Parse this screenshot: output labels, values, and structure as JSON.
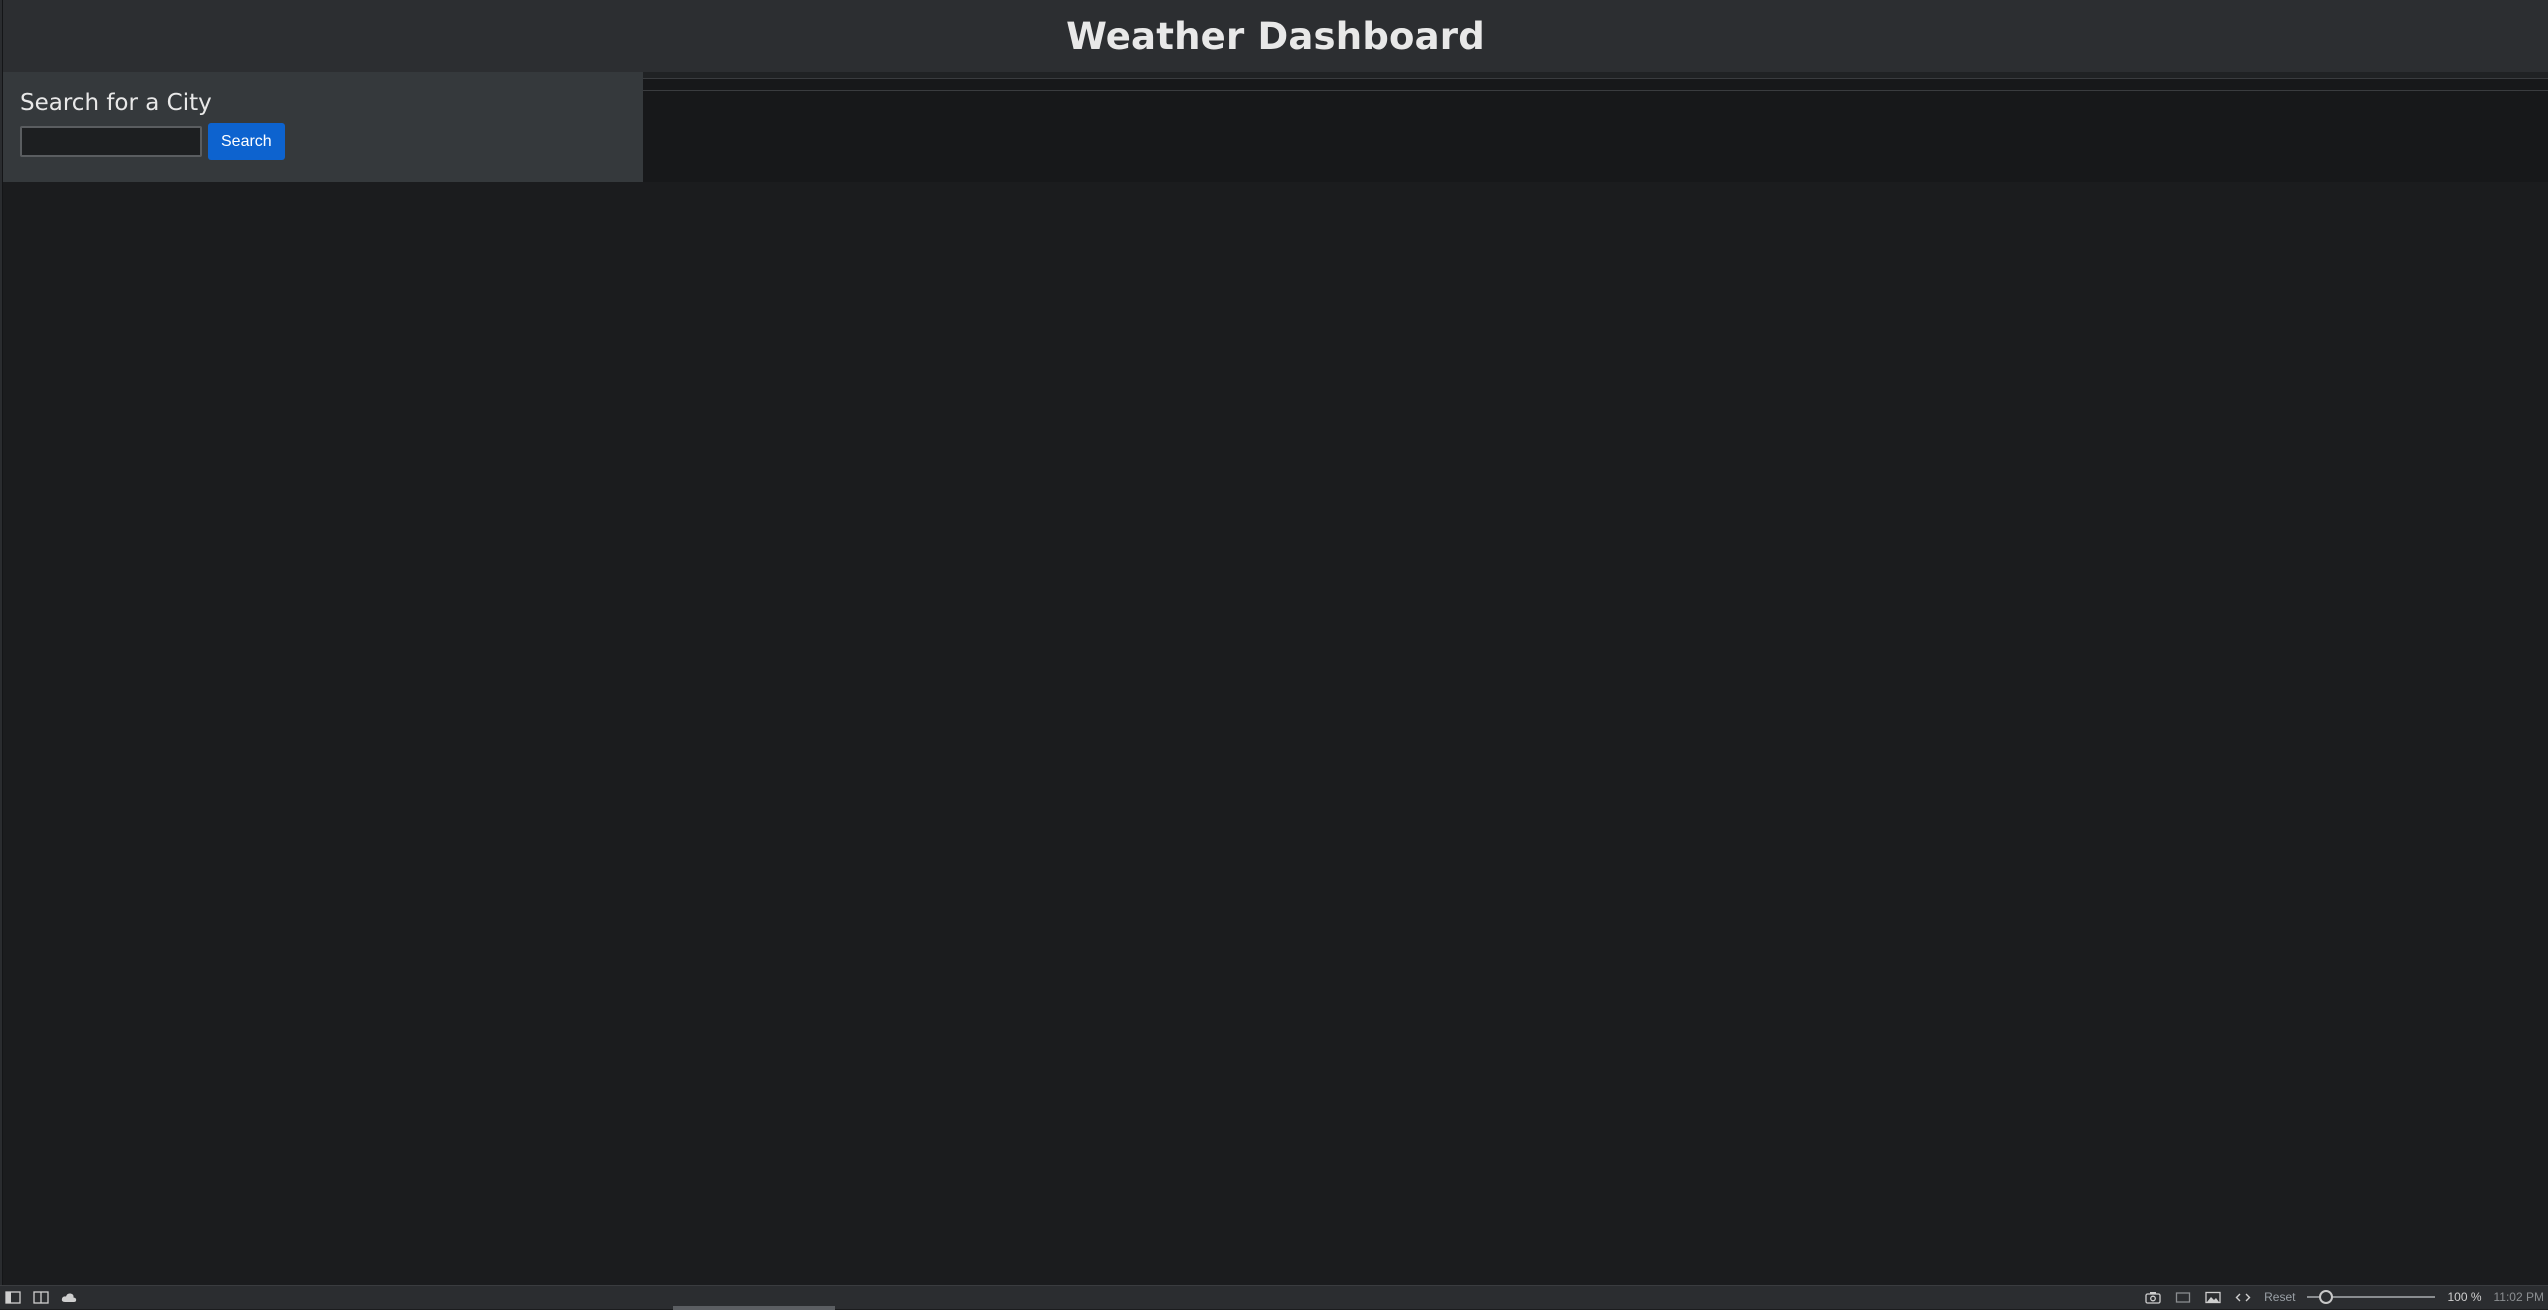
{
  "header": {
    "title": "Weather Dashboard"
  },
  "search": {
    "title": "Search for a City",
    "input_value": "",
    "input_placeholder": "",
    "button_label": "Search"
  },
  "colors": {
    "accent": "#0d63cf",
    "header_bg": "#2c2e31",
    "panel_bg": "#35393c",
    "page_bg": "#1b1c1e"
  },
  "statusbar": {
    "left_icons": [
      "panel-icon",
      "split-view-icon",
      "cloud-icon"
    ],
    "right_icons": [
      "camera-icon",
      "window-icon",
      "image-icon",
      "code-icon"
    ],
    "reset_label": "Reset",
    "zoom_value": 100,
    "zoom_label": "100 %",
    "clock": "11:02 PM"
  }
}
